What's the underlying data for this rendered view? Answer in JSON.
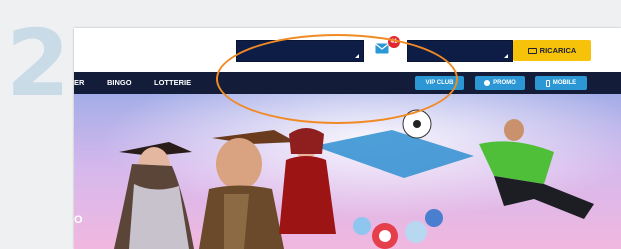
{
  "step": {
    "number": "2"
  },
  "header": {
    "mail_badge": "41",
    "recharge_label": "RICARICA"
  },
  "nav": {
    "items": [
      "ER",
      "BINGO",
      "LOTTERIE"
    ],
    "buttons": [
      "VIP CLUB",
      "PROMO",
      "MOBILE"
    ]
  },
  "hero": {
    "edge_text": "O"
  },
  "colors": {
    "navbar": "#131d3a",
    "selects": "#0e1d45",
    "recharge": "#f7c20a",
    "nav_buttons": "#2b97d4",
    "highlight_ring": "#f08a24",
    "step_number": "#c9dbe7"
  },
  "icons": [
    "mail-icon",
    "card-icon",
    "promo-icon",
    "mobile-icon",
    "caret-icon"
  ]
}
